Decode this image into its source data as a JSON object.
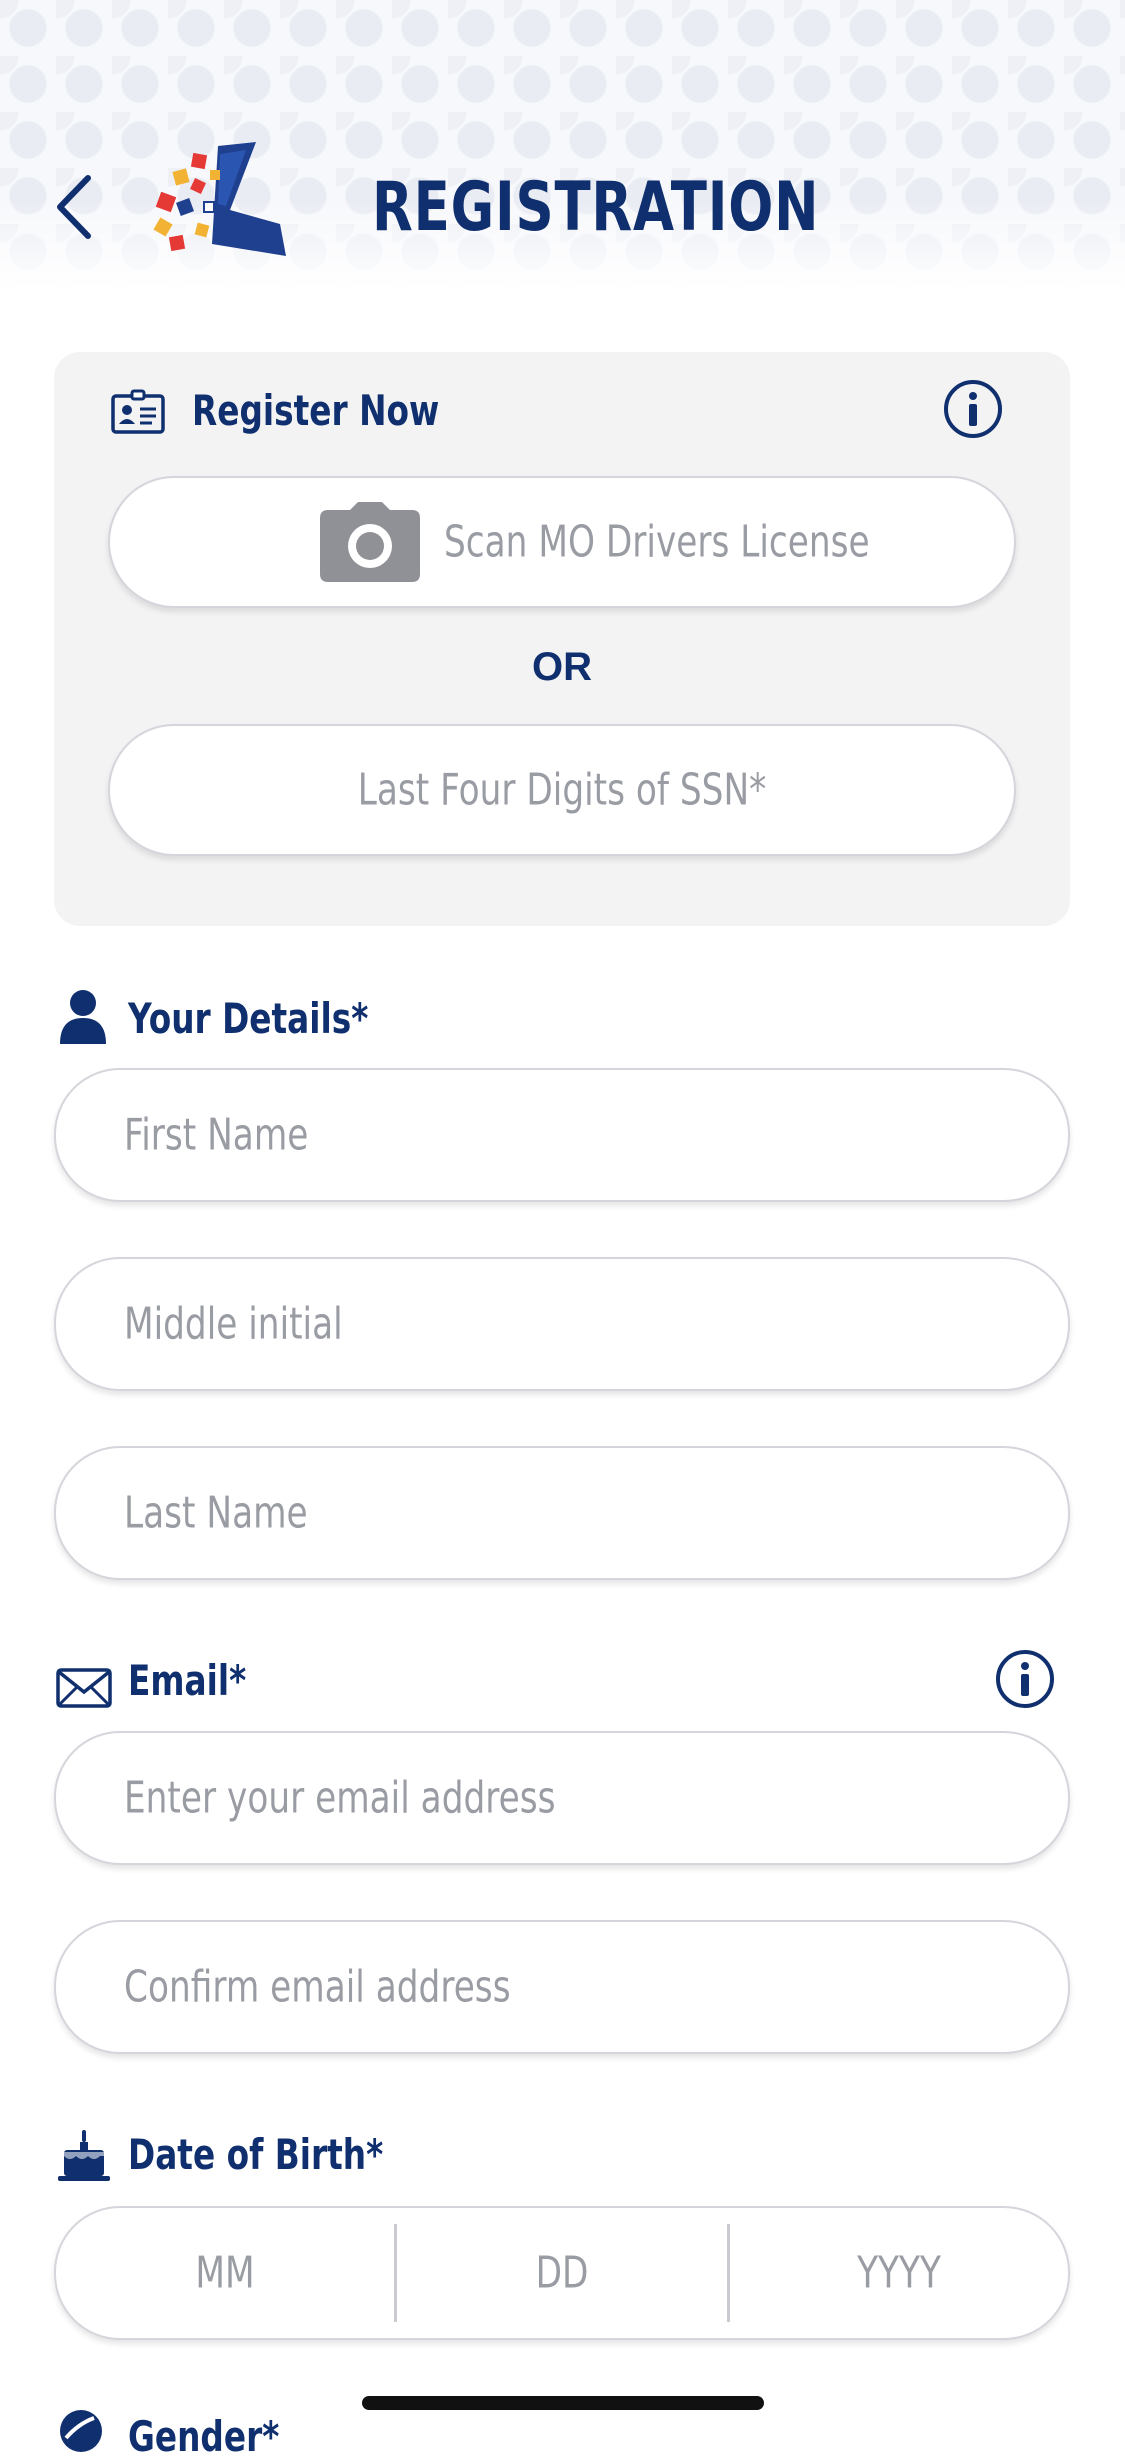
{
  "header": {
    "title": "REGISTRATION"
  },
  "register_now": {
    "title": "Register Now",
    "scan_button_label": "Scan MO Drivers License",
    "or_label": "OR",
    "ssn_placeholder": "Last Four Digits of SSN*"
  },
  "details": {
    "title": "Your Details*",
    "first_name_placeholder": "First Name",
    "middle_initial_placeholder": "Middle initial",
    "last_name_placeholder": "Last Name"
  },
  "email": {
    "title": "Email*",
    "email_placeholder": "Enter your email address",
    "confirm_placeholder": "Confirm email address"
  },
  "dob": {
    "title": "Date of Birth*",
    "mm_placeholder": "MM",
    "dd_placeholder": "DD",
    "yyyy_placeholder": "YYYY"
  },
  "gender": {
    "title": "Gender*"
  },
  "colors": {
    "brand_navy": "#0f2f6e",
    "card_bg": "#f3f3f4",
    "placeholder": "#9a9ca3"
  },
  "icons": [
    "chevron-left-icon",
    "app-logo",
    "id-card-icon",
    "info-icon",
    "camera-icon",
    "person-icon",
    "envelope-icon",
    "cake-icon"
  ]
}
